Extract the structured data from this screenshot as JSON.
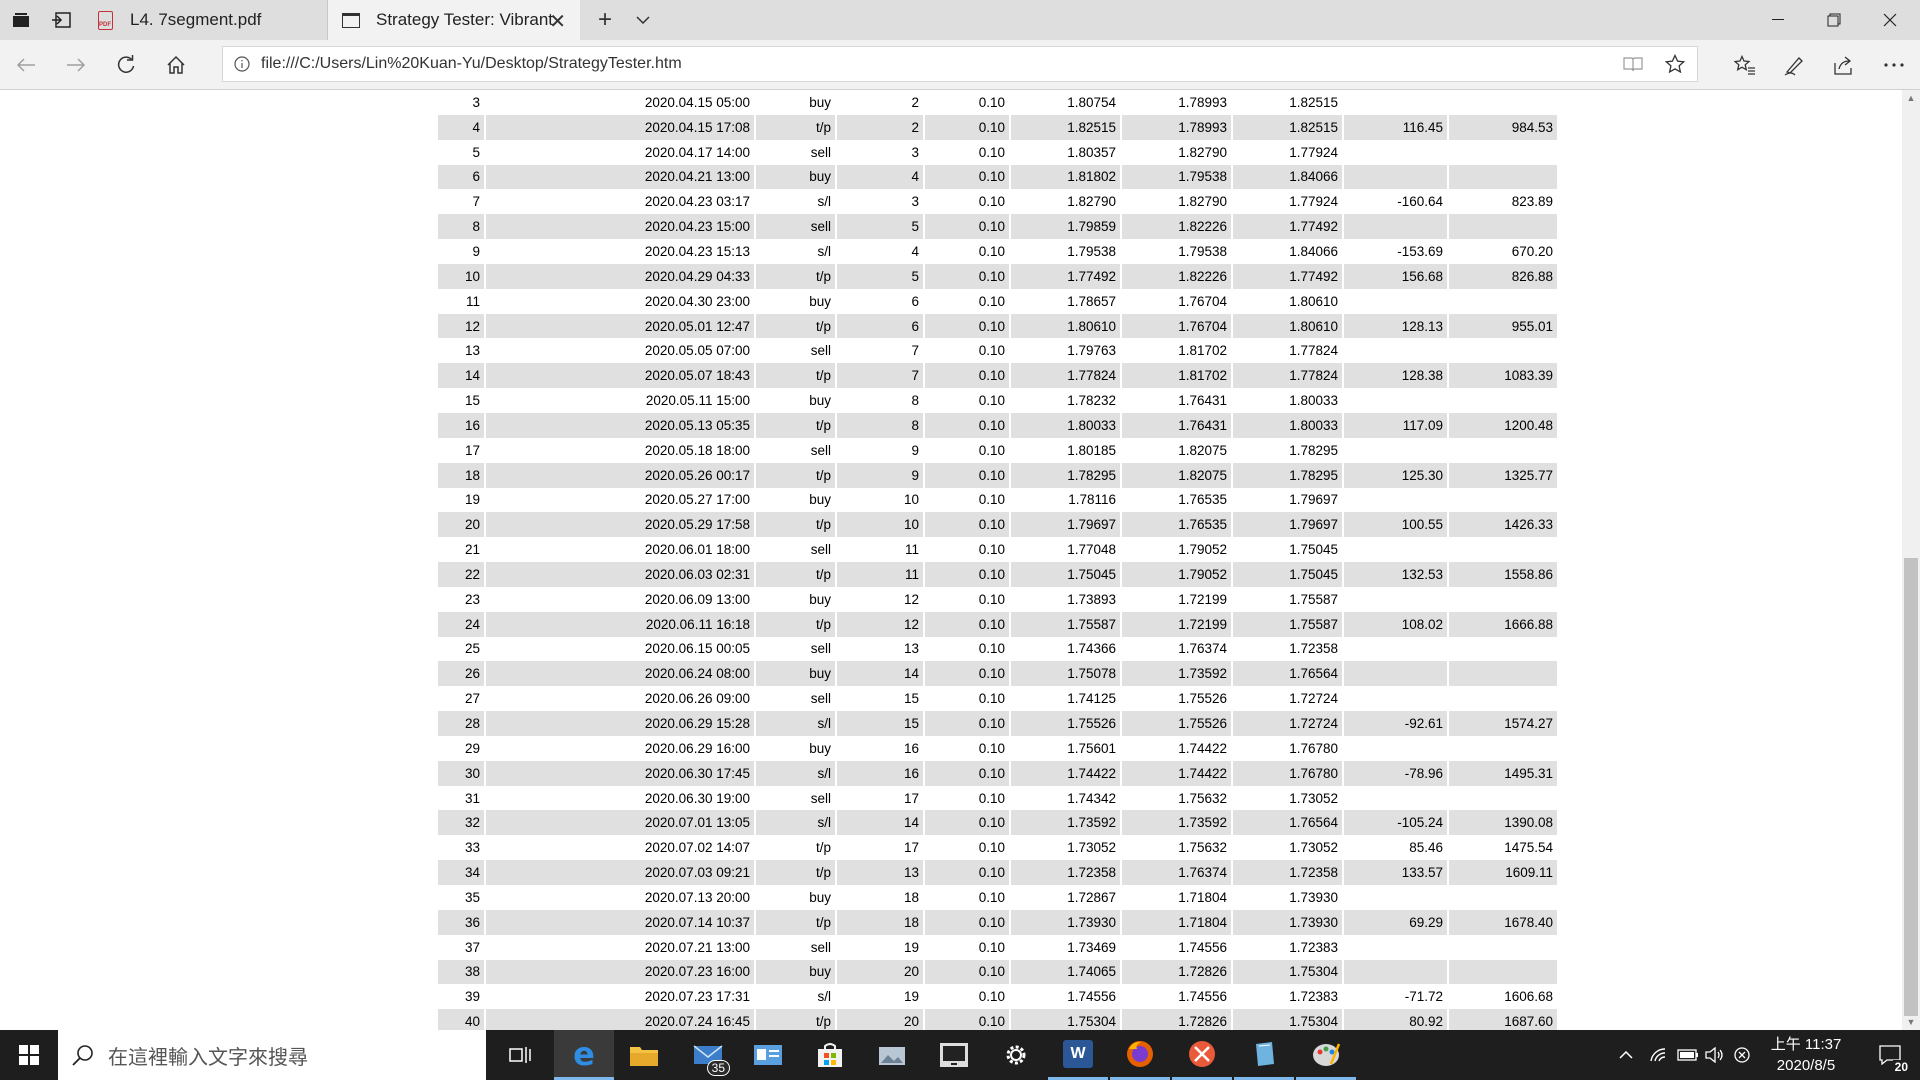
{
  "browser": {
    "tabs": [
      {
        "title": "L4. 7segment.pdf",
        "icon": "pdf-icon",
        "active": false
      },
      {
        "title": "Strategy Tester: Vibrant",
        "icon": "page-icon",
        "active": true
      }
    ],
    "url": "file:///C:/Users/Lin%20Kuan-Yu/Desktop/StrategyTester.htm"
  },
  "table": {
    "rows": [
      [
        "3",
        "2020.04.15 05:00",
        "buy",
        "2",
        "0.10",
        "1.80754",
        "1.78993",
        "1.82515",
        "",
        ""
      ],
      [
        "4",
        "2020.04.15 17:08",
        "t/p",
        "2",
        "0.10",
        "1.82515",
        "1.78993",
        "1.82515",
        "116.45",
        "984.53"
      ],
      [
        "5",
        "2020.04.17 14:00",
        "sell",
        "3",
        "0.10",
        "1.80357",
        "1.82790",
        "1.77924",
        "",
        ""
      ],
      [
        "6",
        "2020.04.21 13:00",
        "buy",
        "4",
        "0.10",
        "1.81802",
        "1.79538",
        "1.84066",
        "",
        ""
      ],
      [
        "7",
        "2020.04.23 03:17",
        "s/l",
        "3",
        "0.10",
        "1.82790",
        "1.82790",
        "1.77924",
        "-160.64",
        "823.89"
      ],
      [
        "8",
        "2020.04.23 15:00",
        "sell",
        "5",
        "0.10",
        "1.79859",
        "1.82226",
        "1.77492",
        "",
        ""
      ],
      [
        "9",
        "2020.04.23 15:13",
        "s/l",
        "4",
        "0.10",
        "1.79538",
        "1.79538",
        "1.84066",
        "-153.69",
        "670.20"
      ],
      [
        "10",
        "2020.04.29 04:33",
        "t/p",
        "5",
        "0.10",
        "1.77492",
        "1.82226",
        "1.77492",
        "156.68",
        "826.88"
      ],
      [
        "11",
        "2020.04.30 23:00",
        "buy",
        "6",
        "0.10",
        "1.78657",
        "1.76704",
        "1.80610",
        "",
        ""
      ],
      [
        "12",
        "2020.05.01 12:47",
        "t/p",
        "6",
        "0.10",
        "1.80610",
        "1.76704",
        "1.80610",
        "128.13",
        "955.01"
      ],
      [
        "13",
        "2020.05.05 07:00",
        "sell",
        "7",
        "0.10",
        "1.79763",
        "1.81702",
        "1.77824",
        "",
        ""
      ],
      [
        "14",
        "2020.05.07 18:43",
        "t/p",
        "7",
        "0.10",
        "1.77824",
        "1.81702",
        "1.77824",
        "128.38",
        "1083.39"
      ],
      [
        "15",
        "2020.05.11 15:00",
        "buy",
        "8",
        "0.10",
        "1.78232",
        "1.76431",
        "1.80033",
        "",
        ""
      ],
      [
        "16",
        "2020.05.13 05:35",
        "t/p",
        "8",
        "0.10",
        "1.80033",
        "1.76431",
        "1.80033",
        "117.09",
        "1200.48"
      ],
      [
        "17",
        "2020.05.18 18:00",
        "sell",
        "9",
        "0.10",
        "1.80185",
        "1.82075",
        "1.78295",
        "",
        ""
      ],
      [
        "18",
        "2020.05.26 00:17",
        "t/p",
        "9",
        "0.10",
        "1.78295",
        "1.82075",
        "1.78295",
        "125.30",
        "1325.77"
      ],
      [
        "19",
        "2020.05.27 17:00",
        "buy",
        "10",
        "0.10",
        "1.78116",
        "1.76535",
        "1.79697",
        "",
        ""
      ],
      [
        "20",
        "2020.05.29 17:58",
        "t/p",
        "10",
        "0.10",
        "1.79697",
        "1.76535",
        "1.79697",
        "100.55",
        "1426.33"
      ],
      [
        "21",
        "2020.06.01 18:00",
        "sell",
        "11",
        "0.10",
        "1.77048",
        "1.79052",
        "1.75045",
        "",
        ""
      ],
      [
        "22",
        "2020.06.03 02:31",
        "t/p",
        "11",
        "0.10",
        "1.75045",
        "1.79052",
        "1.75045",
        "132.53",
        "1558.86"
      ],
      [
        "23",
        "2020.06.09 13:00",
        "buy",
        "12",
        "0.10",
        "1.73893",
        "1.72199",
        "1.75587",
        "",
        ""
      ],
      [
        "24",
        "2020.06.11 16:18",
        "t/p",
        "12",
        "0.10",
        "1.75587",
        "1.72199",
        "1.75587",
        "108.02",
        "1666.88"
      ],
      [
        "25",
        "2020.06.15 00:05",
        "sell",
        "13",
        "0.10",
        "1.74366",
        "1.76374",
        "1.72358",
        "",
        ""
      ],
      [
        "26",
        "2020.06.24 08:00",
        "buy",
        "14",
        "0.10",
        "1.75078",
        "1.73592",
        "1.76564",
        "",
        ""
      ],
      [
        "27",
        "2020.06.26 09:00",
        "sell",
        "15",
        "0.10",
        "1.74125",
        "1.75526",
        "1.72724",
        "",
        ""
      ],
      [
        "28",
        "2020.06.29 15:28",
        "s/l",
        "15",
        "0.10",
        "1.75526",
        "1.75526",
        "1.72724",
        "-92.61",
        "1574.27"
      ],
      [
        "29",
        "2020.06.29 16:00",
        "buy",
        "16",
        "0.10",
        "1.75601",
        "1.74422",
        "1.76780",
        "",
        ""
      ],
      [
        "30",
        "2020.06.30 17:45",
        "s/l",
        "16",
        "0.10",
        "1.74422",
        "1.74422",
        "1.76780",
        "-78.96",
        "1495.31"
      ],
      [
        "31",
        "2020.06.30 19:00",
        "sell",
        "17",
        "0.10",
        "1.74342",
        "1.75632",
        "1.73052",
        "",
        ""
      ],
      [
        "32",
        "2020.07.01 13:05",
        "s/l",
        "14",
        "0.10",
        "1.73592",
        "1.73592",
        "1.76564",
        "-105.24",
        "1390.08"
      ],
      [
        "33",
        "2020.07.02 14:07",
        "t/p",
        "17",
        "0.10",
        "1.73052",
        "1.75632",
        "1.73052",
        "85.46",
        "1475.54"
      ],
      [
        "34",
        "2020.07.03 09:21",
        "t/p",
        "13",
        "0.10",
        "1.72358",
        "1.76374",
        "1.72358",
        "133.57",
        "1609.11"
      ],
      [
        "35",
        "2020.07.13 20:00",
        "buy",
        "18",
        "0.10",
        "1.72867",
        "1.71804",
        "1.73930",
        "",
        ""
      ],
      [
        "36",
        "2020.07.14 10:37",
        "t/p",
        "18",
        "0.10",
        "1.73930",
        "1.71804",
        "1.73930",
        "69.29",
        "1678.40"
      ],
      [
        "37",
        "2020.07.21 13:00",
        "sell",
        "19",
        "0.10",
        "1.73469",
        "1.74556",
        "1.72383",
        "",
        ""
      ],
      [
        "38",
        "2020.07.23 16:00",
        "buy",
        "20",
        "0.10",
        "1.74065",
        "1.72826",
        "1.75304",
        "",
        ""
      ],
      [
        "39",
        "2020.07.23 17:31",
        "s/l",
        "19",
        "0.10",
        "1.74556",
        "1.74556",
        "1.72383",
        "-71.72",
        "1606.68"
      ],
      [
        "40",
        "2020.07.24 16:45",
        "t/p",
        "20",
        "0.10",
        "1.75304",
        "1.72826",
        "1.75304",
        "80.92",
        "1687.60"
      ]
    ]
  },
  "taskbar": {
    "search_placeholder": "在這裡輸入文字來搜尋",
    "mail_badge": "35",
    "clock_period_time": "上午 11:37",
    "clock_date": "2020/8/5",
    "notification_count": "20"
  },
  "colors": {
    "row_alt": "#e0e0e0",
    "taskbar_bg": "#1e1e1e",
    "tab_active_bg": "#f2f2f2"
  }
}
